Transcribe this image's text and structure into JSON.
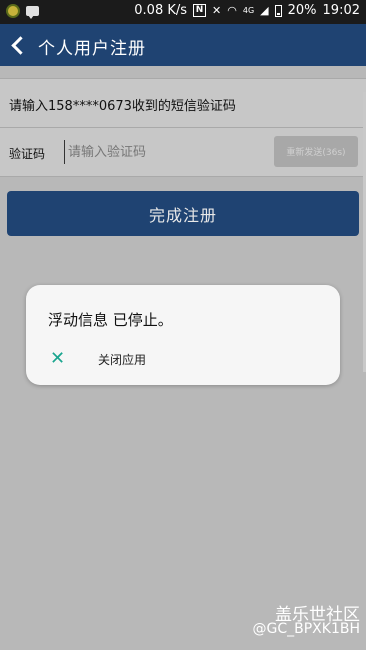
{
  "status_bar": {
    "net_speed": "0.08 K/s",
    "nfc": "N",
    "network": "4G",
    "battery": "20%",
    "time": "19:02"
  },
  "header": {
    "title": "个人用户注册"
  },
  "verification": {
    "prompt": "请输入158****0673收到的短信验证码",
    "code_label": "验证码",
    "code_placeholder": "请输入验证码",
    "code_value": "",
    "resend_label": "重新发送(36s)"
  },
  "submit_label": "完成注册",
  "dialog": {
    "message": "浮动信息 已停止。",
    "close_app_label": "关闭应用"
  },
  "watermark": {
    "line1": "盖乐世社区",
    "line2": "@GC_BPXK1BH"
  },
  "colors": {
    "header": "#1f4372",
    "dim_overlay": "#b8b8b8",
    "dialog_accent": "#1aa58f"
  },
  "icons": {
    "back": "back-arrow-icon",
    "close": "close-x-icon"
  }
}
